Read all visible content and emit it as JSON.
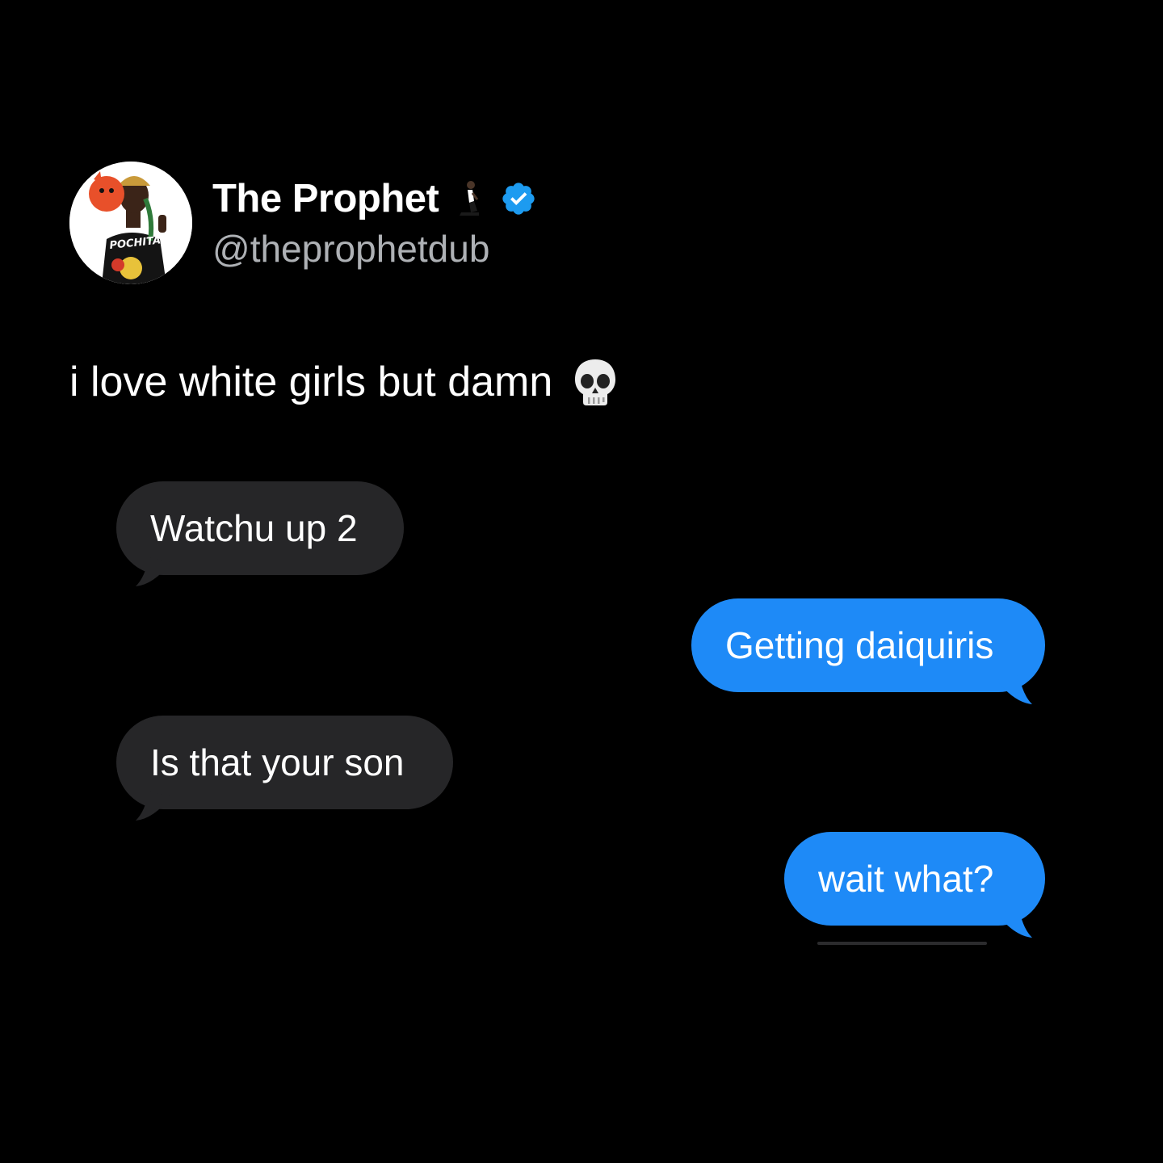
{
  "tweet": {
    "display_name": "The Prophet",
    "handle": "@theprophetdub",
    "text": "i love white girls but damn",
    "avatar_shirt_text": "POCHITA",
    "icons": {
      "name_emoji": "kneeling-person-icon",
      "badge": "verified-badge-icon",
      "text_emoji": "skull-icon"
    },
    "badge_color": "#1d9bf0"
  },
  "conversation": {
    "messages": [
      {
        "direction": "received",
        "text": "Watchu up 2"
      },
      {
        "direction": "sent",
        "text": "Getting daiquiris"
      },
      {
        "direction": "received",
        "text": "Is that your son"
      },
      {
        "direction": "sent",
        "text": "wait what?"
      }
    ],
    "colors": {
      "received_bubble": "#262628",
      "sent_bubble": "#1e8af7",
      "background": "#000000"
    }
  }
}
